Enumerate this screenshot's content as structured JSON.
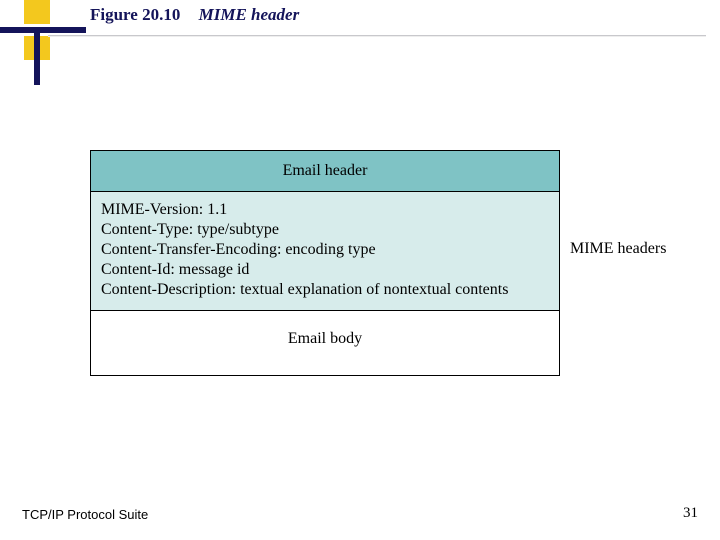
{
  "figure": {
    "number": "Figure 20.10",
    "caption": "MIME header"
  },
  "diagram": {
    "email_header_label": "Email header",
    "mime_lines": {
      "l0": "MIME-Version: 1.1",
      "l1": "Content-Type: type/subtype",
      "l2": "Content-Transfer-Encoding: encoding type",
      "l3": "Content-Id: message id",
      "l4": "Content-Description: textual explanation of nontextual contents"
    },
    "email_body_label": "Email body",
    "mime_side_label": "MIME headers"
  },
  "footer": {
    "left": "TCP/IP Protocol Suite",
    "page": "31"
  }
}
